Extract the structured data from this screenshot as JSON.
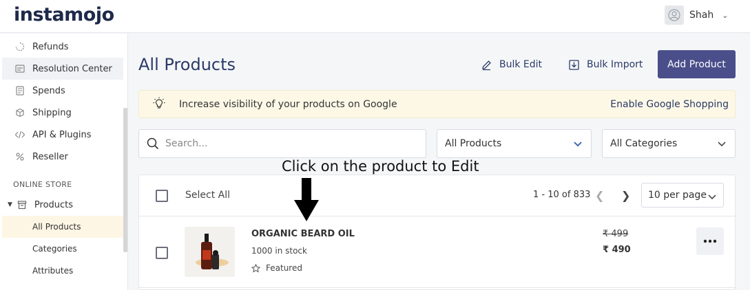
{
  "brand": {
    "logo_text": "instamojo",
    "accent_color": "#e04b6b",
    "primary_color": "#4a4e8a"
  },
  "user": {
    "name": "Shah"
  },
  "sidebar": {
    "items": [
      {
        "label": "Refunds",
        "icon": "refund-icon"
      },
      {
        "label": "Resolution Center",
        "icon": "resolution-icon"
      },
      {
        "label": "Spends",
        "icon": "spends-icon"
      },
      {
        "label": "Shipping",
        "icon": "shipping-icon"
      },
      {
        "label": "API & Plugins",
        "icon": "code-icon"
      },
      {
        "label": "Reseller",
        "icon": "percent-icon"
      }
    ],
    "section_label": "ONLINE STORE",
    "store_group": {
      "label": "Products",
      "icon": "store-icon"
    },
    "sub_items": [
      {
        "label": "All Products"
      },
      {
        "label": "Categories"
      },
      {
        "label": "Attributes"
      }
    ]
  },
  "main": {
    "title": "All Products",
    "bulk_edit_label": "Bulk Edit",
    "bulk_import_label": "Bulk Import",
    "add_product_label": "Add Product",
    "banner": {
      "text": "Increase visibility of your products on Google",
      "link": "Enable Google Shopping"
    },
    "search": {
      "placeholder": "Search..."
    },
    "filter_products": "All Products",
    "filter_categories": "All Categories",
    "annotation": "Click on the product to Edit",
    "list": {
      "select_all_label": "Select All",
      "range_text": "1 - 10 of 833",
      "per_page": "10 per page",
      "products": [
        {
          "name": "ORGANIC BEARD OIL",
          "stock": "1000 in stock",
          "featured_label": "Featured",
          "old_price": "₹ 499",
          "price": "₹ 490"
        }
      ]
    }
  }
}
